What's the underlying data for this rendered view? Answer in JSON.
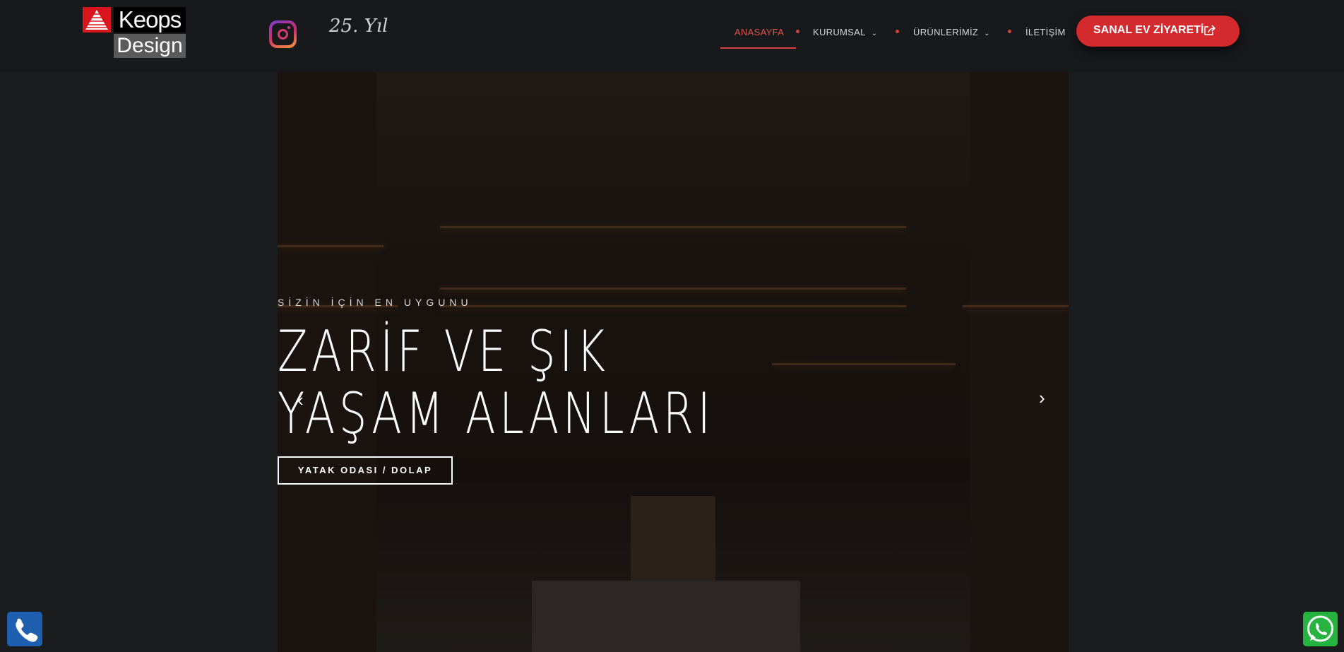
{
  "header": {
    "logo": {
      "top": "Keops",
      "bottom": "Design"
    },
    "anniversary": "25. Yıl",
    "nav": [
      {
        "label": "ANASAYFA",
        "active": true
      },
      {
        "label": "KURUMSAL",
        "dropdown": true
      },
      {
        "label": "ÜRÜNLERİMİZ",
        "dropdown": true
      },
      {
        "label": "İLETİŞİM"
      }
    ],
    "cta_label": "SANAL EV ZİYARETİ"
  },
  "hero": {
    "subtitle": "SİZİN İÇİN EN UYGUNU",
    "title_line1": "ZARİF VE ŞIK",
    "title_line2": "YAŞAM ALANLARI",
    "button_label": "YATAK ODASI / DOLAP",
    "prev": "‹",
    "next": "›"
  },
  "colors": {
    "accent": "#d42a2e",
    "background": "#18191b",
    "phone": "#1f5fb0",
    "whatsapp": "#27b340"
  }
}
